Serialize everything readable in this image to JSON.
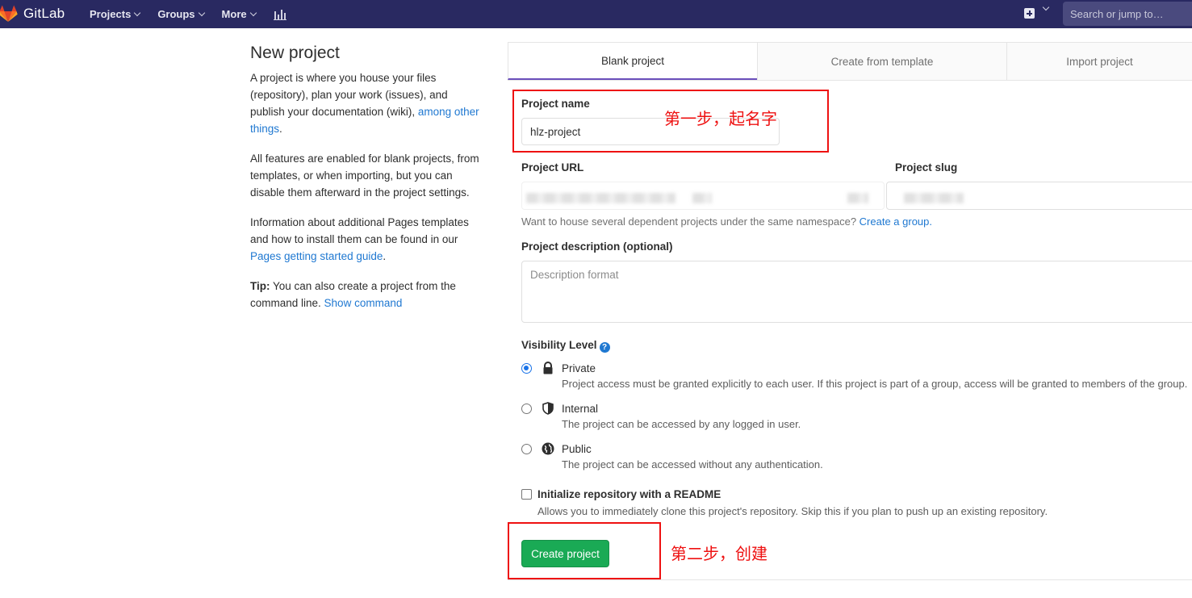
{
  "navbar": {
    "brand": "GitLab",
    "items": [
      {
        "label": "Projects"
      },
      {
        "label": "Groups"
      },
      {
        "label": "More"
      }
    ],
    "search_placeholder": "Search or jump to…",
    "bg_color": "#292961"
  },
  "sidebar": {
    "title": "New project",
    "p1_text": "A project is where you house your files (repository), plan your work (issues), and publish your documentation (wiki), ",
    "p1_link": "among other things",
    "p1_end": ".",
    "p2_text": "All features are enabled for blank projects, from templates, or when importing, but you can disable them afterward in the project settings.",
    "p3_text": "Information about additional Pages templates and how to install them can be found in our ",
    "p3_link": "Pages getting started guide",
    "p3_end": ".",
    "p4_bold": "Tip:",
    "p4_text": " You can also create a project from the command line. ",
    "p4_link": "Show command"
  },
  "tabs": [
    {
      "label": "Blank project",
      "active": true
    },
    {
      "label": "Create from template",
      "active": false
    },
    {
      "label": "Import project",
      "active": false
    }
  ],
  "form": {
    "project_name_label": "Project name",
    "project_name_value": "hlz-project",
    "project_url_label": "Project URL",
    "project_slug_label": "Project slug",
    "namespace_help_text": "Want to house several dependent projects under the same namespace? ",
    "namespace_help_link": "Create a group.",
    "description_label": "Project description (optional)",
    "description_placeholder": "Description format",
    "visibility_label": "Visibility Level",
    "visibility_options": [
      {
        "title": "Private",
        "desc": "Project access must be granted explicitly to each user. If this project is part of a group, access will be granted to members of the group.",
        "checked": true,
        "icon": "lock-icon"
      },
      {
        "title": "Internal",
        "desc": "The project can be accessed by any logged in user.",
        "checked": false,
        "icon": "shield-icon"
      },
      {
        "title": "Public",
        "desc": "The project can be accessed without any authentication.",
        "checked": false,
        "icon": "globe-icon"
      }
    ],
    "readme_label": "Initialize repository with a README",
    "readme_desc": "Allows you to immediately clone this project's repository. Skip this if you plan to push up an existing repository.",
    "readme_checked": false,
    "submit_label": "Create project"
  },
  "annotations": {
    "step1": "第一步，起名字",
    "step2": "第二步，创建",
    "color": "#e11111"
  },
  "colors": {
    "accent_link": "#1f78d1",
    "create_button": "#1aaa55",
    "active_tab_underline": "#6b4fbb"
  }
}
